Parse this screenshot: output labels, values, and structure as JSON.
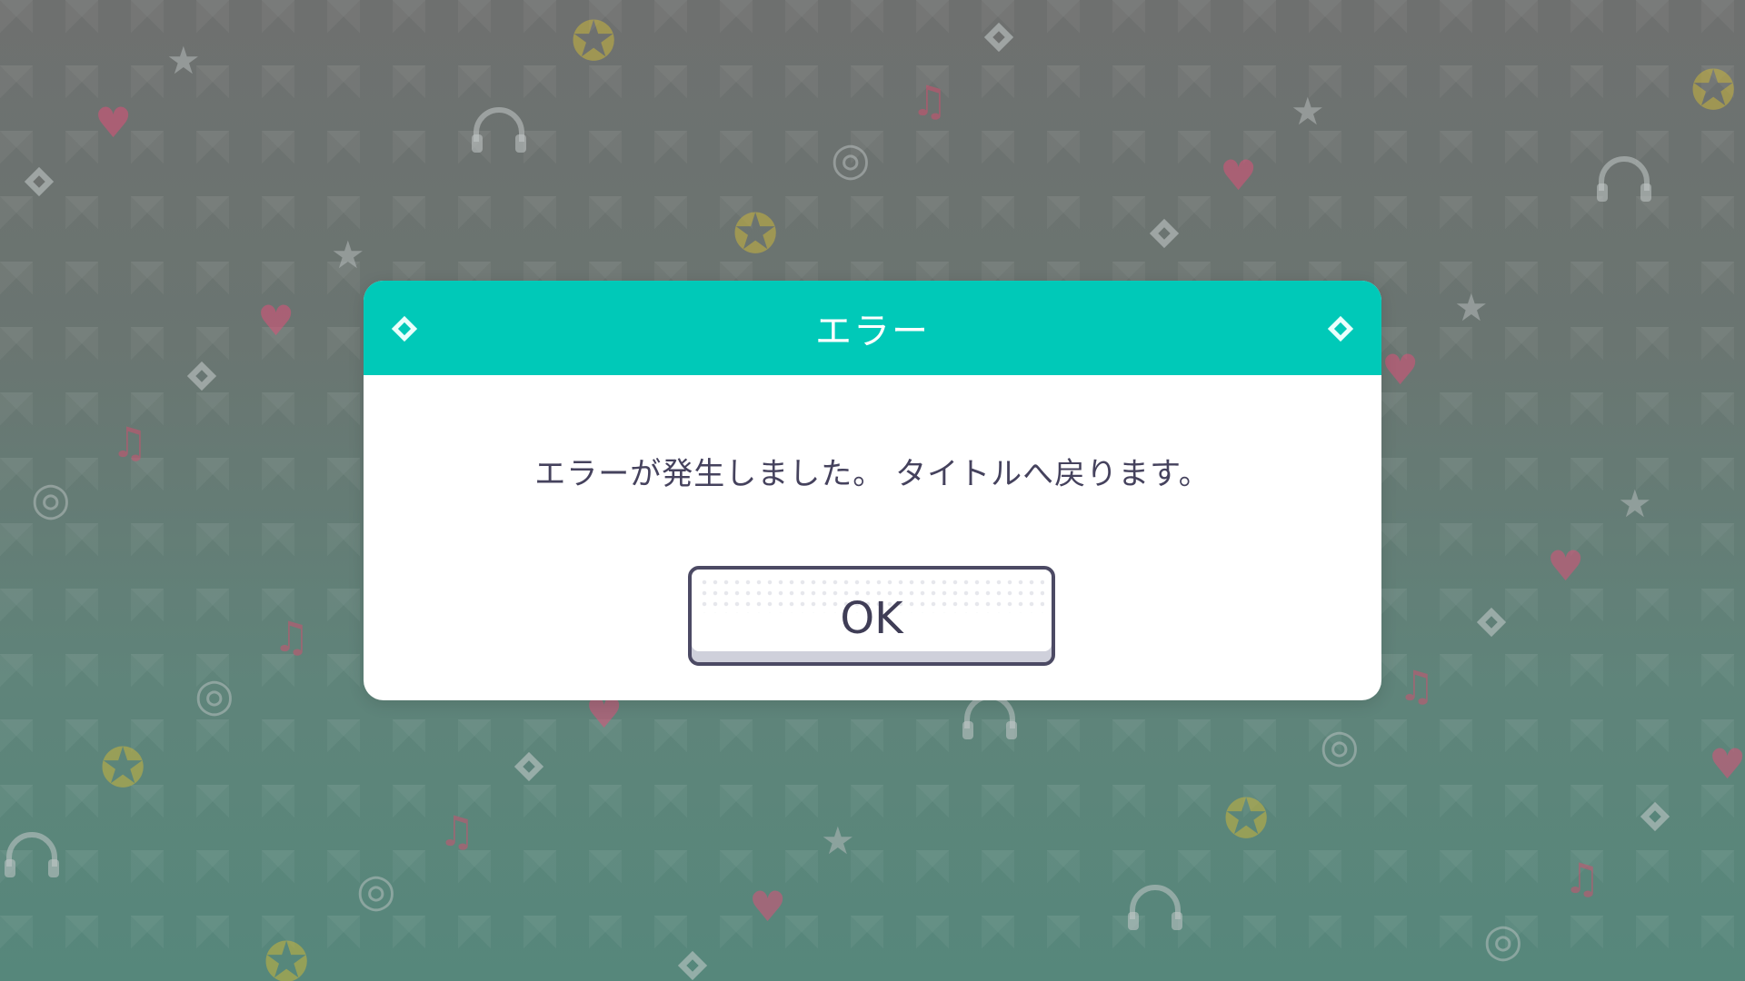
{
  "dialog": {
    "title": "エラー",
    "message": "エラーが発生しました。 タイトルへ戻ります。",
    "ok_label": "OK"
  },
  "colors": {
    "header": "#00c9b8",
    "text": "#45425d",
    "button_border": "#4c4a64"
  },
  "icons": [
    "diamond-icon",
    "star-icon",
    "heart-icon",
    "music-note-icon",
    "disc-icon",
    "crown-star-icon",
    "headphones-icon"
  ]
}
